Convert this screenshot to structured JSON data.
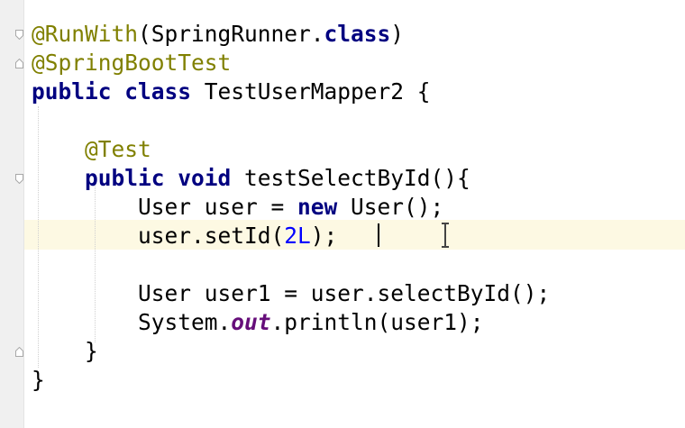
{
  "editor": {
    "lines": [
      {
        "name": "line-1",
        "tokens": [
          {
            "t": "@RunWith",
            "c": "ann"
          },
          {
            "t": "(SpringRunner.",
            "c": ""
          },
          {
            "t": "class",
            "c": "kw"
          },
          {
            "t": ")",
            "c": ""
          }
        ]
      },
      {
        "name": "line-2",
        "tokens": [
          {
            "t": "@SpringBootTest",
            "c": "ann"
          }
        ]
      },
      {
        "name": "line-3",
        "tokens": [
          {
            "t": "public class ",
            "c": "kw"
          },
          {
            "t": "TestUserMapper2 {",
            "c": ""
          }
        ]
      },
      {
        "name": "line-4",
        "tokens": []
      },
      {
        "name": "line-5",
        "tokens": [
          {
            "t": "    ",
            "c": ""
          },
          {
            "t": "@Test",
            "c": "ann"
          }
        ]
      },
      {
        "name": "line-6",
        "tokens": [
          {
            "t": "    ",
            "c": ""
          },
          {
            "t": "public void ",
            "c": "kw"
          },
          {
            "t": "testSelectById(){",
            "c": ""
          }
        ]
      },
      {
        "name": "line-7",
        "tokens": [
          {
            "t": "        User user = ",
            "c": ""
          },
          {
            "t": "new ",
            "c": "kw"
          },
          {
            "t": "User();",
            "c": ""
          }
        ]
      },
      {
        "name": "line-8",
        "tokens": [
          {
            "t": "        user.setId(",
            "c": ""
          },
          {
            "t": "2L",
            "c": "num"
          },
          {
            "t": ");",
            "c": ""
          }
        ]
      },
      {
        "name": "line-9",
        "tokens": []
      },
      {
        "name": "line-10",
        "tokens": [
          {
            "t": "        User user1 = user.selectById();",
            "c": ""
          }
        ]
      },
      {
        "name": "line-11",
        "tokens": [
          {
            "t": "        System.",
            "c": ""
          },
          {
            "t": "out",
            "c": "field"
          },
          {
            "t": ".println(user1);",
            "c": ""
          }
        ]
      },
      {
        "name": "line-12",
        "tokens": [
          {
            "t": "    }",
            "c": ""
          }
        ]
      },
      {
        "name": "line-13",
        "tokens": [
          {
            "t": "}",
            "c": ""
          }
        ]
      }
    ]
  }
}
